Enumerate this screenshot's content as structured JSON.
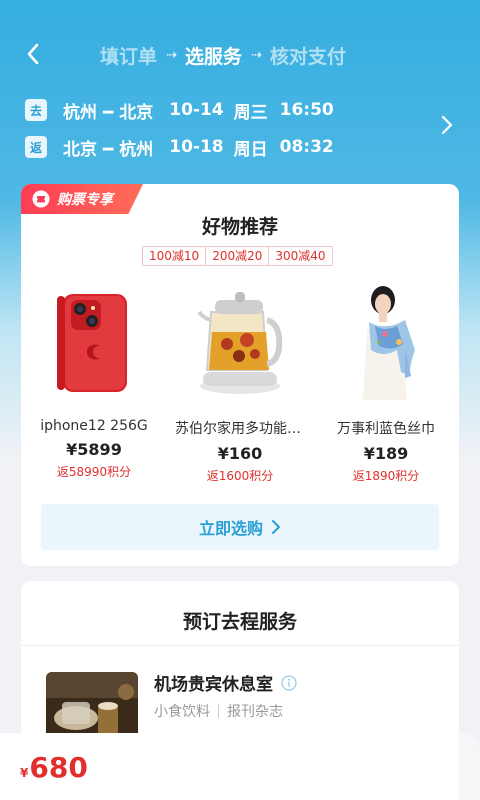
{
  "header": {
    "steps": [
      "填订单",
      "选服务",
      "核对支付"
    ],
    "active_step": 1,
    "arrow_glyph": "⇢"
  },
  "trips": [
    {
      "tag": "去",
      "from": "杭州",
      "to": "北京",
      "date": "10-14",
      "weekday": "周三",
      "time": "16:50"
    },
    {
      "tag": "返",
      "from": "北京",
      "to": "杭州",
      "date": "10-18",
      "weekday": "周日",
      "time": "08:32"
    }
  ],
  "promo": {
    "ribbon": "购票专享",
    "title": "好物推荐",
    "coupons": [
      "100减10",
      "200减20",
      "300减40"
    ],
    "products": [
      {
        "name": "iphone12 256G",
        "price": "¥5899",
        "points": "返58990积分",
        "icon": "iphone-image"
      },
      {
        "name": "苏伯尔家用多功能养生壶",
        "price": "¥160",
        "points": "返1600积分",
        "icon": "kettle-image"
      },
      {
        "name": "万事利蓝色丝巾",
        "price": "¥189",
        "points": "返1890积分",
        "icon": "scarf-model-image"
      }
    ],
    "buy_label": "立即选购"
  },
  "service": {
    "title": "预订去程服务",
    "item": {
      "name": "机场贵宾休息室",
      "tags": [
        "小食饮料",
        "报刊杂志"
      ],
      "icon": "lounge-image"
    }
  },
  "footer": {
    "currency": "¥",
    "total": "680"
  },
  "colors": {
    "header_blue": "#35aee0",
    "accent_red": "#e0302e",
    "link_blue": "#2a9fd6"
  }
}
